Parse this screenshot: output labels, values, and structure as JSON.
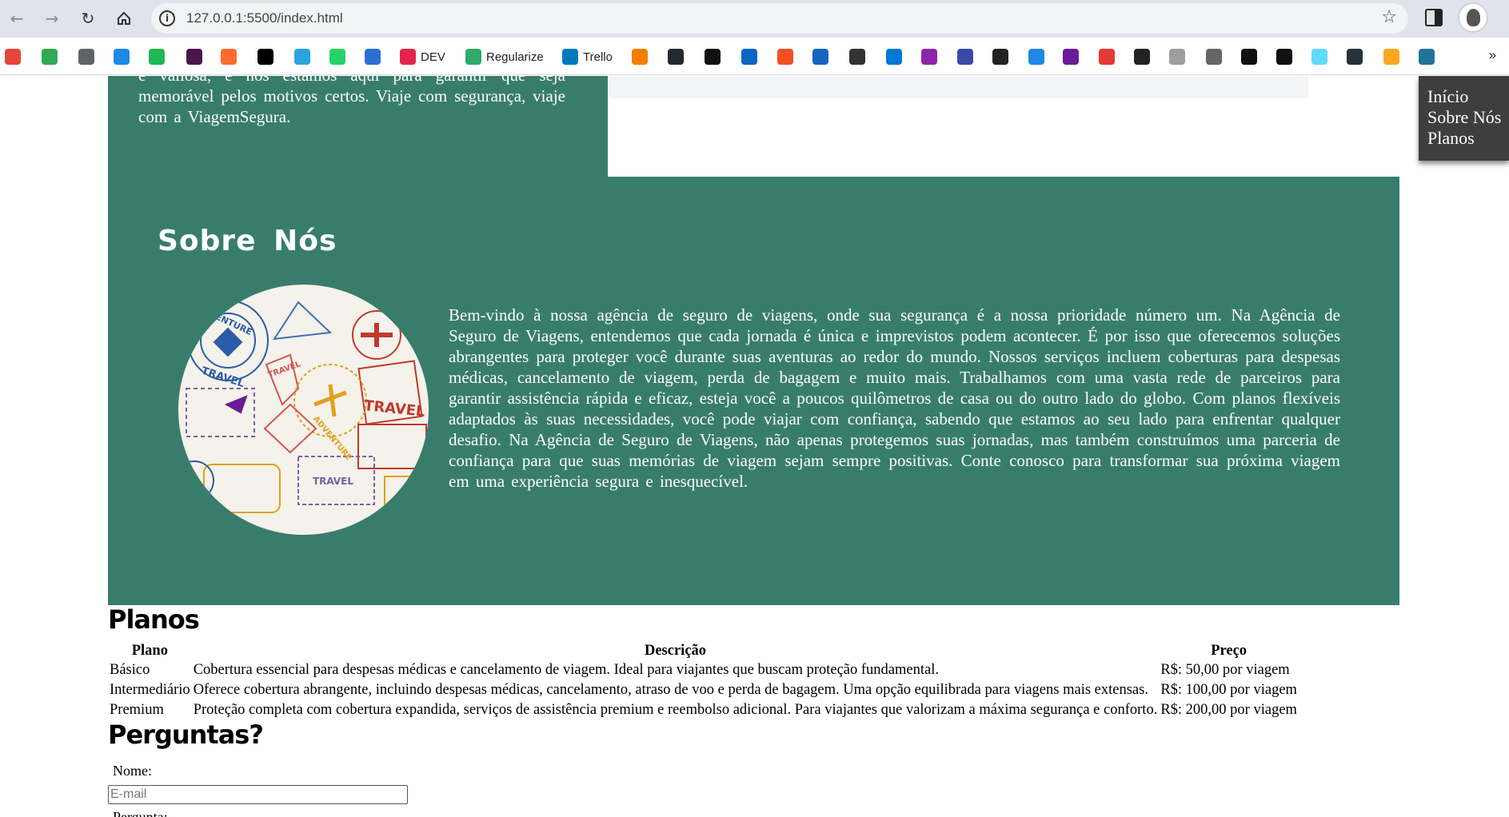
{
  "browser": {
    "url": "127.0.0.1:5500/index.html",
    "bookmarks": [
      {
        "icon": "chrome-icon",
        "label": "",
        "color": "#e8453c"
      },
      {
        "icon": "gdrive-icon",
        "label": "",
        "color": "#34a853"
      },
      {
        "icon": "globe-icon",
        "label": "",
        "color": "#5f6368"
      },
      {
        "icon": "cloud-icon",
        "label": "",
        "color": "#1e88e5"
      },
      {
        "icon": "spotify-icon",
        "label": "",
        "color": "#1db954"
      },
      {
        "icon": "m-icon",
        "label": "",
        "color": "#4a154b"
      },
      {
        "icon": "c-icon",
        "label": "",
        "color": "#ff6a2c"
      },
      {
        "icon": "x-icon",
        "label": "",
        "color": "#000000"
      },
      {
        "icon": "telegram-icon",
        "label": "",
        "color": "#2aa3e0"
      },
      {
        "icon": "whatsapp-icon",
        "label": "",
        "color": "#25d366"
      },
      {
        "icon": "s-icon",
        "label": "",
        "color": "#2d6ed6"
      },
      {
        "icon": "dev-icon",
        "label": "DEV",
        "color": "#e6244a"
      },
      {
        "icon": "regularize-icon",
        "label": "Regularize",
        "color": "#2eaa6b"
      },
      {
        "icon": "trello-icon",
        "label": "Trello",
        "color": "#0079bf"
      },
      {
        "icon": "grid-icon",
        "label": "",
        "color": "#f57c00"
      },
      {
        "icon": "github-icon",
        "label": "",
        "color": "#24292e"
      },
      {
        "icon": "triangle-icon",
        "label": "",
        "color": "#111111"
      },
      {
        "icon": "linkedin-icon",
        "label": "",
        "color": "#0a66c2"
      },
      {
        "icon": "microsoft-icon",
        "label": "",
        "color": "#f25022"
      },
      {
        "icon": "w-icon",
        "label": "",
        "color": "#1565c0"
      },
      {
        "icon": "knot-icon",
        "label": "",
        "color": "#333333"
      },
      {
        "icon": "outlook-icon",
        "label": "",
        "color": "#0078d4"
      },
      {
        "icon": "u-icon",
        "label": "",
        "color": "#8e24aa"
      },
      {
        "icon": "hex-icon",
        "label": "",
        "color": "#3949ab"
      },
      {
        "icon": "nin-icon",
        "label": "",
        "color": "#222222"
      },
      {
        "icon": "drop-icon",
        "label": "",
        "color": "#1e88e5"
      },
      {
        "icon": "mask-icon",
        "label": "",
        "color": "#6a1b9a"
      },
      {
        "icon": "check-icon",
        "label": "",
        "color": "#e53935"
      },
      {
        "icon": "openai-icon",
        "label": "",
        "color": "#222222"
      },
      {
        "icon": "wave-icon",
        "label": "",
        "color": "#9e9e9e"
      },
      {
        "icon": "j-icon",
        "label": "",
        "color": "#666666"
      },
      {
        "icon": "g-icon",
        "label": "",
        "color": "#111111"
      },
      {
        "icon": "r-icon",
        "label": "",
        "color": "#111111"
      },
      {
        "icon": "react-icon",
        "label": "",
        "color": "#61dafb"
      },
      {
        "icon": "chip-icon",
        "label": "",
        "color": "#263238"
      },
      {
        "icon": "n-icon",
        "label": "",
        "color": "#f9a825"
      },
      {
        "icon": "wordpress-icon",
        "label": "",
        "color": "#21759b"
      }
    ]
  },
  "hero": {
    "text": "é valiosa, e nós estamos aqui para garantir que seja memorável pelos motivos certos. Viaje com segurança, viaje com a ViagemSegura."
  },
  "nav": {
    "items": [
      "Início",
      "Sobre Nós",
      "Planos"
    ]
  },
  "about": {
    "title": "Sobre Nós",
    "text": "Bem-vindo à nossa agência de seguro de viagens, onde sua segurança é a nossa prioridade número um. Na Agência de Seguro de Viagens, entendemos que cada jornada é única e imprevistos podem acontecer. É por isso que oferecemos soluções abrangentes para proteger você durante suas aventuras ao redor do mundo. Nossos serviços incluem coberturas para despesas médicas, cancelamento de viagem, perda de bagagem e muito mais. Trabalhamos com uma vasta rede de parceiros para garantir assistência rápida e eficaz, esteja você a poucos quilômetros de casa ou do outro lado do globo. Com planos flexíveis adaptados às suas necessidades, você pode viajar com confiança, sabendo que estamos ao seu lado para enfrentar qualquer desafio. Na Agência de Seguro de Viagens, não apenas protegemos suas jornadas, mas também construímos uma parceria de confiança para que suas memórias de viagem sejam sempre positivas. Conte conosco para transformar sua próxima viagem em uma experiência segura e inesquecível.",
    "stamps": [
      "ADVENTURE",
      "TRAVEL",
      "TRAVEL",
      "TRAVEL",
      "ADVENTURE",
      "TRAVEL"
    ]
  },
  "plans": {
    "title": "Planos",
    "headers": [
      "Plano",
      "Descrição",
      "Preço"
    ],
    "rows": [
      [
        "Básico",
        "Cobertura essencial para despesas médicas e cancelamento de viagem. Ideal para viajantes que buscam proteção fundamental.",
        "R$: 50,00 por viagem"
      ],
      [
        "Intermediário",
        "Oferece cobertura abrangente, incluindo despesas médicas, cancelamento, atraso de voo e perda de bagagem. Uma opção equilibrada para viagens mais extensas.",
        "R$: 100,00 por viagem"
      ],
      [
        "Premium",
        "Proteção completa com cobertura expandida, serviços de assistência premium e reembolso adicional. Para viajantes que valorizam a máxima segurança e conforto.",
        "R$: 200,00 por viagem"
      ]
    ]
  },
  "faq": {
    "title": "Perguntas?",
    "name_label": "Nome:",
    "email_placeholder": "E-mail",
    "question_label": "Pergunta:"
  },
  "colors": {
    "section_green": "#387d6c",
    "nav_bg": "#3e3e3e"
  }
}
